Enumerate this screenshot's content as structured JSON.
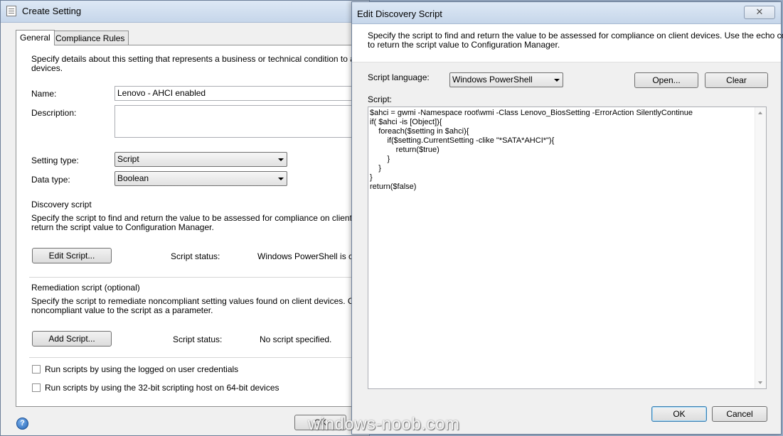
{
  "create_setting": {
    "title": "Create Setting",
    "tabs": [
      "General",
      "Compliance Rules"
    ],
    "intro": "Specify details about this setting that represents a business or technical condition to assess for c",
    "intro_line2": "devices.",
    "name_label": "Name:",
    "name_value": "Lenovo - AHCI enabled",
    "description_label": "Description:",
    "setting_type_label": "Setting type:",
    "setting_type_value": "Script",
    "data_type_label": "Data type:",
    "data_type_value": "Boolean",
    "discovery_heading": "Discovery script",
    "discovery_text_1": "Specify the script to find and return the value to be assessed for compliance on client devices. U",
    "discovery_text_2": "return the script value to Configuration Manager.",
    "edit_script_button": "Edit Script...",
    "script_status_label": "Script status:",
    "discovery_status_value": "Windows PowerShell is crea",
    "remediation_heading": "Remediation script (optional)",
    "remediation_text_1": "Specify the script to remediate noncompliant setting values found on client devices. Configuratio",
    "remediation_text_2": "noncompliant value to the script as a parameter.",
    "add_script_button": "Add Script...",
    "remediation_status_value": "No script specified.",
    "checkbox_logged_on": "Run scripts by using the logged on user credentials",
    "checkbox_32bit": "Run scripts by using the 32-bit scripting host on 64-bit devices",
    "ok_button": "OK",
    "help_icon": "?"
  },
  "edit_discovery": {
    "title": "Edit Discovery Script",
    "close_icon": "close-icon",
    "instructions_1": "Specify the script to find and return the value to be assessed for compliance on client devices. Use the echo command",
    "instructions_2": "to return the script value to Configuration Manager.",
    "script_language_label": "Script language:",
    "script_language_value": "Windows PowerShell",
    "open_button": "Open...",
    "clear_button": "Clear",
    "script_label": "Script:",
    "script_lines": [
      "$ahci = gwmi -Namespace root\\wmi -Class Lenovo_BiosSetting -ErrorAction SilentlyContinue",
      "if( $ahci -is [Object]){",
      "    foreach($setting in $ahci){",
      "        if($setting.CurrentSetting -clike \"*SATA*AHCI*\"){",
      "            return($true)",
      "        }",
      "    }",
      "}",
      "return($false)"
    ],
    "ok_button": "OK",
    "cancel_button": "Cancel"
  },
  "watermark": "windows-noob.com"
}
